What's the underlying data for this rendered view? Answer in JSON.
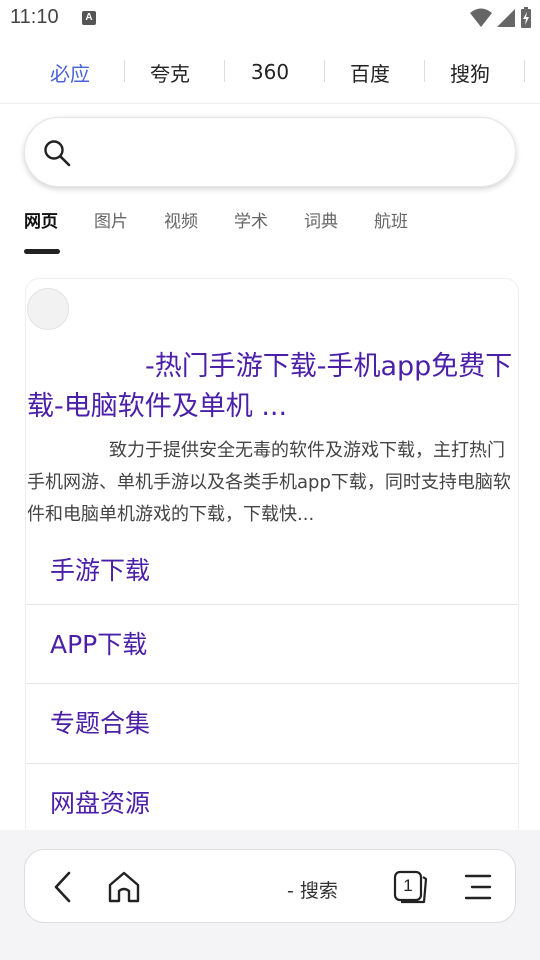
{
  "status": {
    "time": "11:10",
    "notification_badge": "A"
  },
  "engines": [
    {
      "label": "必应",
      "active": true
    },
    {
      "label": "夸克",
      "active": false
    },
    {
      "label": "360",
      "active": false
    },
    {
      "label": "百度",
      "active": false
    },
    {
      "label": "搜狗",
      "active": false
    }
  ],
  "search": {
    "value": "",
    "placeholder": ""
  },
  "categories": [
    {
      "label": "网页",
      "active": true
    },
    {
      "label": "图片",
      "active": false
    },
    {
      "label": "视频",
      "active": false
    },
    {
      "label": "学术",
      "active": false
    },
    {
      "label": "词典",
      "active": false
    },
    {
      "label": "航班",
      "active": false
    }
  ],
  "result": {
    "title": "-热门手游下载-手机app免费下载-电脑软件及单机 ...",
    "snippet": "致力于提供安全无毒的软件及游戏下载，主打热门手机网游、单机手游以及各类手机app下载，同时支持电脑软件和电脑单机游戏的下载，下载快...",
    "sublinks": [
      "手游下载",
      "APP下载",
      "专题合集",
      "网盘资源"
    ]
  },
  "toolbar": {
    "label": "- 搜索",
    "tab_count": "1"
  },
  "colors": {
    "accent": "#4a63d8",
    "link": "#4b1fa8"
  }
}
